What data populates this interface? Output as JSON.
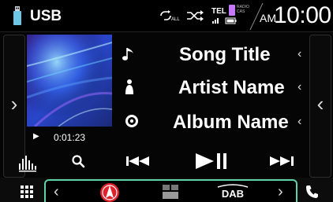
{
  "status_bar": {
    "source_title": "USB",
    "tel_label": "TEL",
    "radio_indicator": [
      "RADIO",
      "CAS"
    ],
    "am_label": "AM",
    "clock": "10:00",
    "icons": [
      "usb-icon",
      "loop-all-icon",
      "shuffle-icon",
      "phone-signal-icon",
      "battery-icon"
    ]
  },
  "track": {
    "title": "Song Title",
    "artist": "Artist Name",
    "album": "Album Name",
    "elapsed": "0:01:23",
    "playing": true
  },
  "controls": {
    "icons": [
      "equalizer-icon",
      "search-icon",
      "previous-track-icon",
      "play-pause-icon",
      "next-track-icon"
    ]
  },
  "launcher": {
    "icons": [
      "prev-page-chevron-icon",
      "navigation-icon",
      "screen-mirror-icon",
      "dab-icon",
      "next-page-chevron-icon"
    ],
    "dab_label": "DAB"
  },
  "bottom_bar": {
    "icons": [
      "home-menu-icon",
      "phone-icon"
    ]
  },
  "colors": {
    "accent": "#5fd4a8",
    "background": "#050505",
    "phone_indicator": "#c678ff",
    "nav_icon_red": "#e0202a"
  }
}
